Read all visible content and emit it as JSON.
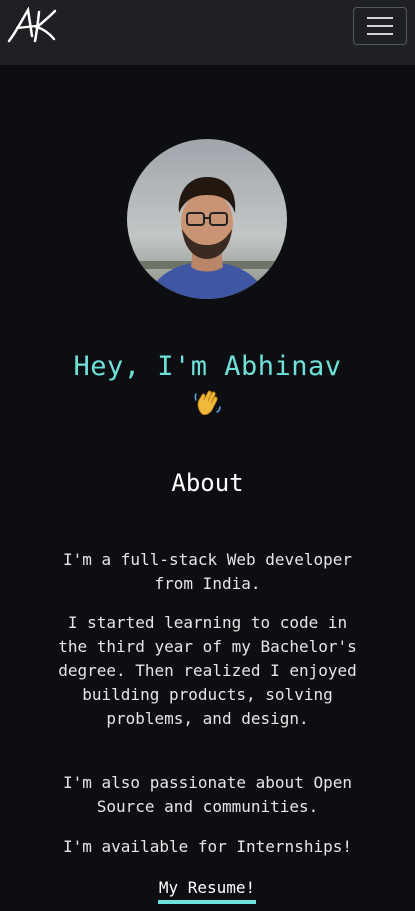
{
  "header": {
    "logo_text": "AK",
    "menu_icon": "hamburger-menu-icon"
  },
  "profile": {
    "avatar_alt": "Abhinav profile photo"
  },
  "hero": {
    "greeting": "Hey, I'm Abhinav",
    "emoji_icon": "waving-hand-icon"
  },
  "about": {
    "title": "About",
    "paragraphs": [
      "I'm a full-stack Web developer from India.",
      "I started learning to code in the third year of my Bachelor's degree. Then realized I enjoyed building products, solving problems, and design.",
      "I'm also passionate about Open Source and communities.",
      "I'm available for Internships!"
    ],
    "resume_link": "My Resume!"
  },
  "colors": {
    "background": "#0d0e11",
    "navbar": "#1e2024",
    "accent": "#6fe1da",
    "text": "#e6e6e6"
  }
}
